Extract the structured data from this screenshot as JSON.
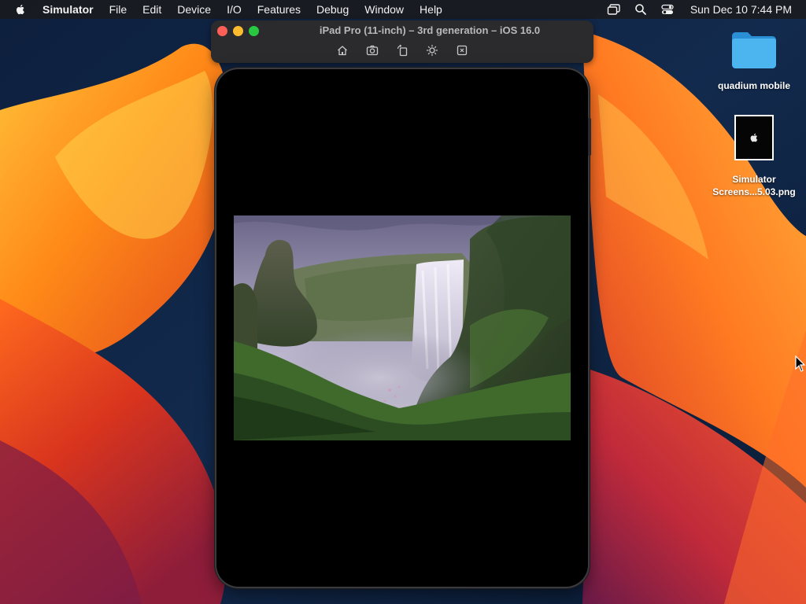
{
  "menubar": {
    "app_name": "Simulator",
    "items": [
      "File",
      "Edit",
      "Device",
      "I/O",
      "Features",
      "Debug",
      "Window",
      "Help"
    ],
    "clock": "Sun Dec 10  7:44 PM"
  },
  "simulator": {
    "title": "iPad Pro (11-inch) – 3rd generation – iOS 16.0",
    "toolbar": [
      "home-icon",
      "screenshot-icon",
      "rotate-icon",
      "appearance-icon",
      "shake-icon"
    ]
  },
  "desktop": {
    "folder_label": "quadium mobile",
    "file_label_line1": "Simulator",
    "file_label_line2": "Screens...5.03.png"
  },
  "colors": {
    "wallpaper_orange": "#ff8a1a",
    "wallpaper_red": "#e8482a",
    "wallpaper_navy": "#0b1a33",
    "folder_blue": "#3aa6e8",
    "close": "#fe5f57",
    "minimize": "#febc2e",
    "zoom": "#28c840"
  }
}
